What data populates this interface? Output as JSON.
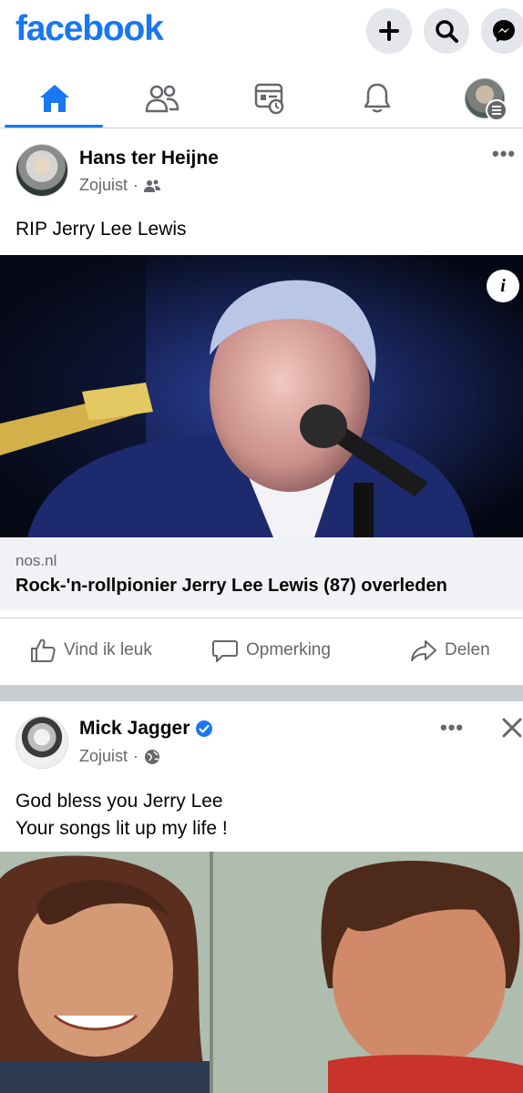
{
  "header": {
    "logo": "facebook",
    "buttons": [
      "plus-icon",
      "search-icon",
      "messenger-icon"
    ]
  },
  "tabs": [
    "home-icon",
    "friends-icon",
    "feeds-icon",
    "notifications-icon",
    "profile-avatar"
  ],
  "colors": {
    "brand": "#1877f2",
    "muted": "#65676b",
    "card": "#f0f2f5",
    "separator": "#c9ccd1",
    "verified": "#1877f2"
  },
  "post1": {
    "author": "Hans ter Heijne",
    "time": "Zojuist",
    "audience_icon": "friends-icon",
    "text": "RIP Jerry Lee Lewis",
    "link_domain": "nos.nl",
    "link_title": "Rock-'n-rollpionier Jerry Lee Lewis (87) overleden",
    "actions": {
      "like": "Vind ik leuk",
      "comment": "Opmerking",
      "share": "Delen"
    }
  },
  "post2": {
    "author": "Mick Jagger",
    "verified": true,
    "time": "Zojuist",
    "audience_icon": "globe-icon",
    "text_line1": "God bless you Jerry Lee",
    "text_line2": "Your songs lit up my life !"
  }
}
